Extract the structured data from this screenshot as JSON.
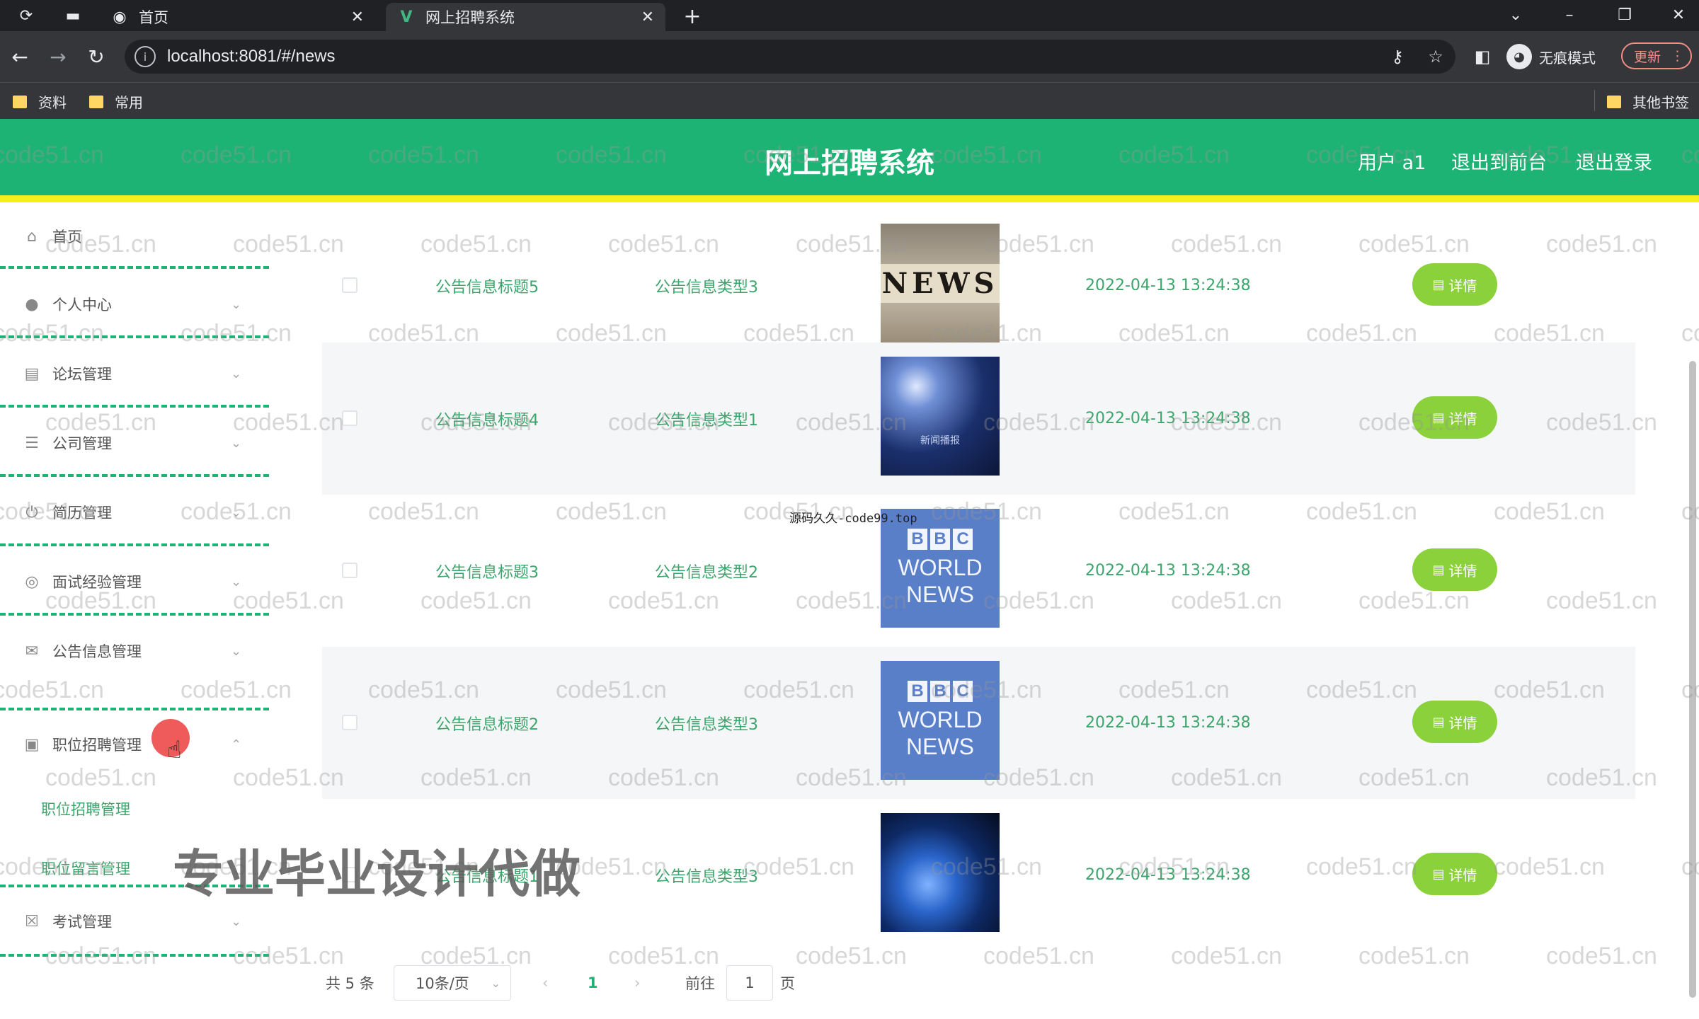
{
  "browser": {
    "tabs": [
      {
        "title": "首页",
        "active": false
      },
      {
        "title": "网上招聘系统",
        "active": true
      }
    ],
    "url": "localhost:8081/#/news",
    "incognito_label": "无痕模式",
    "update_label": "更新",
    "bookmarks": [
      "资料",
      "常用"
    ],
    "other_bookmarks": "其他书签"
  },
  "header": {
    "title": "网上招聘系统",
    "user": "用户 a1",
    "back_to_front": "退出到前台",
    "logout": "退出登录",
    "colors": {
      "bar": "#1db374",
      "accent_line": "#f5ee1f"
    }
  },
  "sidebar": {
    "items": [
      {
        "label": "首页",
        "icon": "home-icon"
      },
      {
        "label": "个人中心",
        "icon": "user-icon"
      },
      {
        "label": "论坛管理",
        "icon": "forum-icon"
      },
      {
        "label": "公司管理",
        "icon": "list-icon"
      },
      {
        "label": "简历管理",
        "icon": "power-icon"
      },
      {
        "label": "面试经验管理",
        "icon": "compass-icon"
      },
      {
        "label": "公告信息管理",
        "icon": "mail-icon"
      },
      {
        "label": "职位招聘管理",
        "icon": "briefcase-icon"
      },
      {
        "label": "考试管理",
        "icon": "exam-icon"
      }
    ],
    "subitems": [
      "职位招聘管理",
      "职位留言管理"
    ]
  },
  "table": {
    "rows": [
      {
        "title": "公告信息标题5",
        "type": "公告信息类型3",
        "image": "news-blocks-image",
        "time": "2022-04-13 13:24:38"
      },
      {
        "title": "公告信息标题4",
        "type": "公告信息类型1",
        "image": "spotlight-image",
        "image_caption": "新闻播报",
        "time": "2022-04-13 13:24:38"
      },
      {
        "title": "公告信息标题3",
        "type": "公告信息类型2",
        "image": "bbc-world-news-image",
        "time": "2022-04-13 13:24:38"
      },
      {
        "title": "公告信息标题2",
        "type": "公告信息类型3",
        "image": "bbc-world-news-image",
        "time": "2022-04-13 13:24:38"
      },
      {
        "title": "公告信息标题1",
        "type": "公告信息类型3",
        "image": "globe-image",
        "time": "2022-04-13 13:24:38"
      }
    ],
    "detail_label": "详情",
    "image_texts": {
      "news": "NEWS",
      "bbc": "BBC",
      "world": "WORLD",
      "news2": "NEWS"
    }
  },
  "pagination": {
    "total": "共 5 条",
    "page_size": "10条/页",
    "current_page": "1",
    "goto_label": "前往",
    "goto_value": "1",
    "page_suffix": "页"
  },
  "overlays": {
    "watermark": "code51.cn",
    "promo": "专业毕业设计代做",
    "small_mark": "源码久久-code99.top"
  }
}
